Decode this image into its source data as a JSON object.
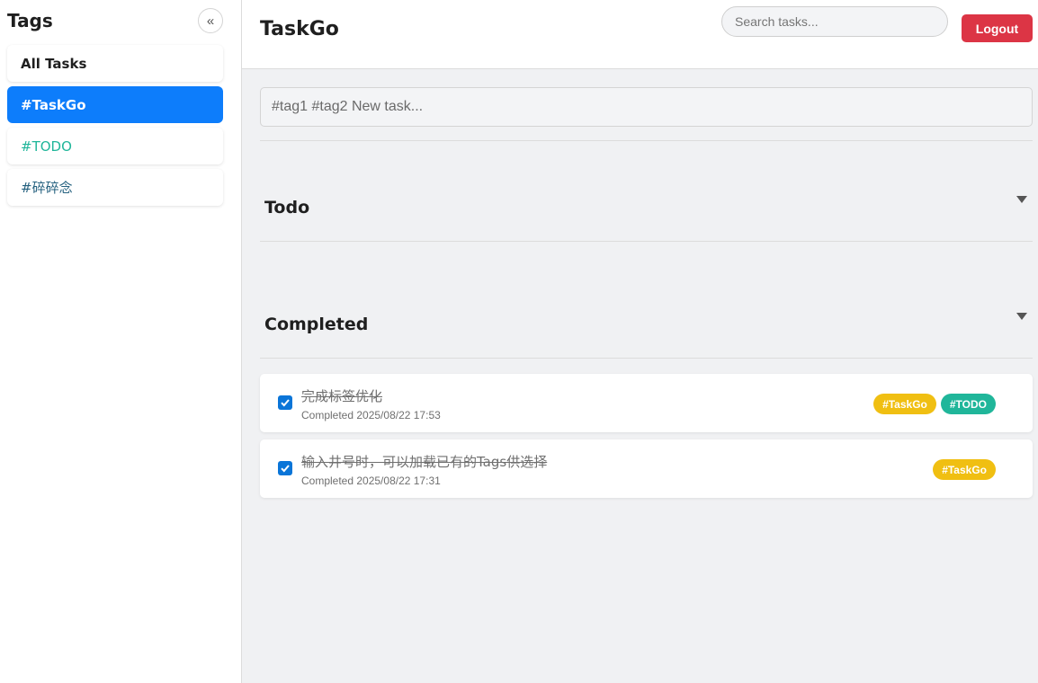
{
  "sidebar": {
    "title": "Tags",
    "collapse_icon": "«",
    "items": [
      {
        "label": "All Tasks"
      },
      {
        "label": "#TaskGo"
      },
      {
        "label": "#TODO"
      },
      {
        "label": "#碎碎念"
      }
    ]
  },
  "header": {
    "title": "TaskGo",
    "search_placeholder": "Search tasks...",
    "logout_label": "Logout"
  },
  "main": {
    "new_task_placeholder": "#tag1 #tag2 New task...",
    "sections": [
      {
        "title": "Todo"
      },
      {
        "title": "Completed"
      }
    ],
    "completed_tasks": [
      {
        "title": "完成标签优化",
        "meta": "Completed 2025/08/22 17:53",
        "tags": [
          "#TaskGo",
          "#TODO"
        ]
      },
      {
        "title": "输入井号时，可以加载已有的Tags供选择",
        "meta": "Completed 2025/08/22 17:31",
        "tags": [
          "#TaskGo"
        ]
      }
    ]
  },
  "colors": {
    "accent": "#0d7dfb",
    "logout": "#dc3545",
    "tag_taskgo": "#f0bf12",
    "tag_todo": "#20b69a",
    "tag_sui": "#25617f"
  }
}
